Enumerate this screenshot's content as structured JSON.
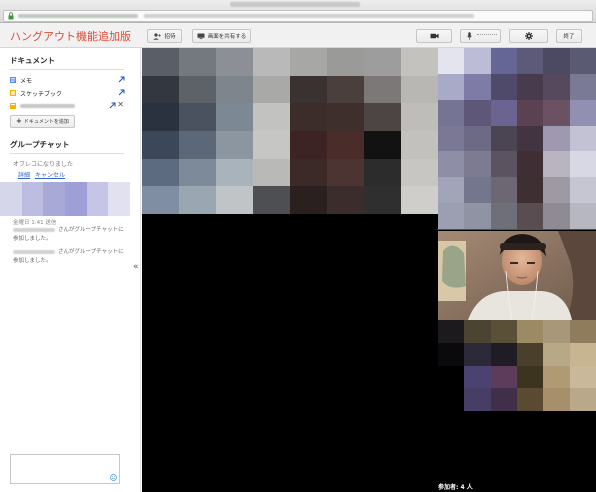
{
  "app": {
    "title": "ハングアウト機能追加版"
  },
  "toolbar": {
    "invite_label": "招待",
    "share_screen_label": "画面を共有する",
    "camera_icon": "video-camera-icon",
    "mic_icon": "microphone-icon",
    "settings_icon": "gear-icon",
    "exit_label": "終了"
  },
  "documents": {
    "header": "ドキュメント",
    "items": [
      {
        "label": "メモ",
        "icon": "notes-doc-icon",
        "color": "#5b8def"
      },
      {
        "label": "スケッチブック",
        "icon": "sketchbook-icon",
        "color": "#f4b400"
      },
      {
        "label": "",
        "icon": "spreadsheet-doc-icon",
        "color": "#f4b400"
      }
    ],
    "add_button": "ドキュメントを追加"
  },
  "chat": {
    "header": "グループチャット",
    "status": "オフレコになりました",
    "details_link": "詳細",
    "cancel_link": "キャンセル",
    "time": "金曜日 1:41 送信",
    "messages": [
      {
        "text": "さんがグループチャットに参加しました。"
      },
      {
        "text": "さんがグループチャットに参加しました。"
      }
    ]
  },
  "stage": {
    "participant_count": "参加者: 4 人"
  },
  "colors": {
    "accent": "#dd4b39",
    "link": "#3366cc",
    "highlight": "#2255aa"
  }
}
